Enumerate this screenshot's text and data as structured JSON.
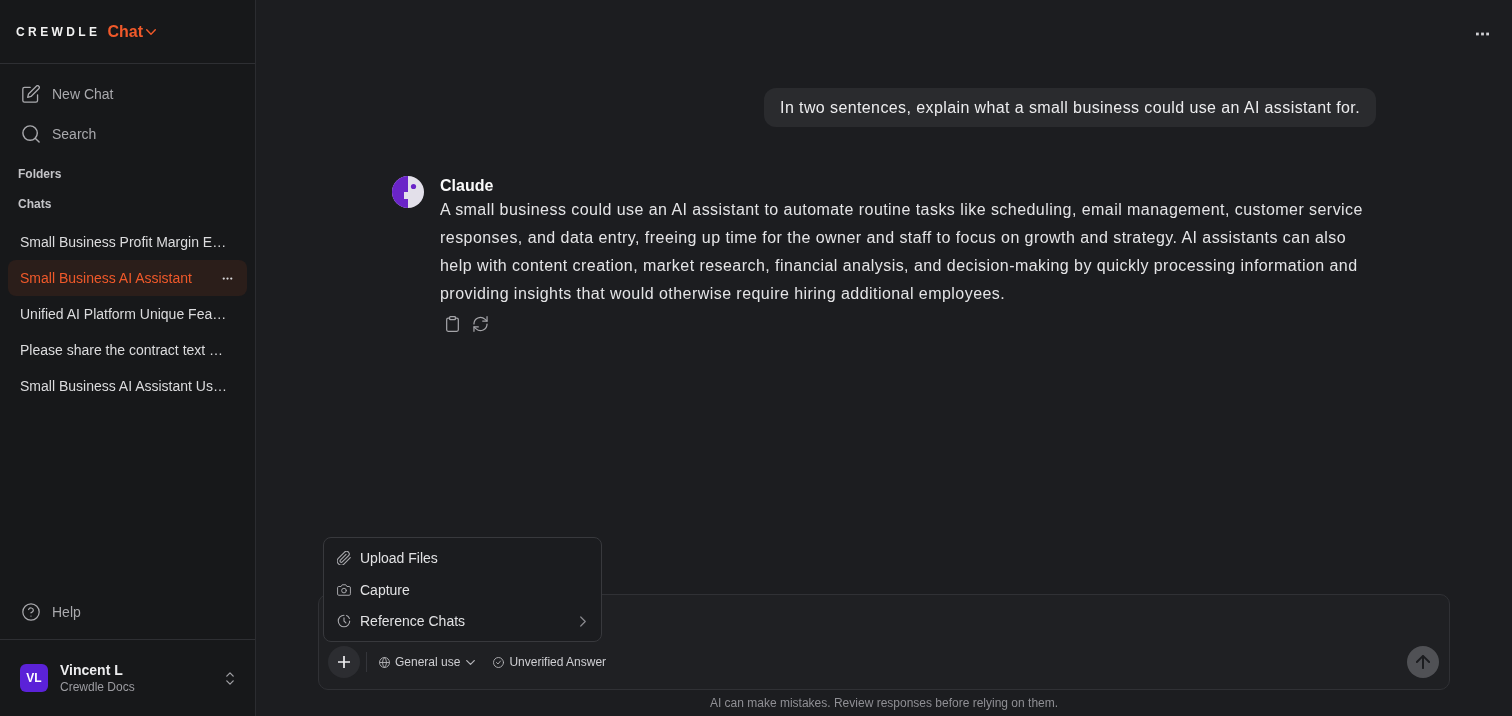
{
  "brand": {
    "wordmark": "CREWDLE",
    "product": "Chat"
  },
  "sidebar": {
    "actions": [
      {
        "kind": "new_chat",
        "label": "New Chat"
      },
      {
        "kind": "search",
        "label": "Search"
      }
    ],
    "folders_heading": "Folders",
    "chats_heading": "Chats",
    "chats": [
      {
        "title": "Small Business Profit Margin E…",
        "selected": false
      },
      {
        "title": "Small Business AI Assistant",
        "selected": true
      },
      {
        "title": "Unified AI Platform Unique Fea…",
        "selected": false
      },
      {
        "title": "Please share the contract text …",
        "selected": false
      },
      {
        "title": "Small Business AI Assistant Us…",
        "selected": false
      }
    ],
    "help": "Help",
    "user": {
      "initials": "VL",
      "name": "Vincent L",
      "workspace": "Crewdle Docs"
    }
  },
  "conversation": [
    {
      "kind": "user",
      "text": "In two sentences, explain what a small business could use an AI assistant for."
    },
    {
      "kind": "assistant",
      "sender": "Claude",
      "text": "A small business could use an AI assistant to automate routine tasks like scheduling, email management, customer service responses, and data entry, freeing up time for the owner and staff to focus on growth and strategy. AI assistants can also help with content creation, market research, financial analysis, and decision-making by quickly processing information and providing insights that would otherwise require hiring additional employees."
    }
  ],
  "composer": {
    "menu": [
      {
        "kind": "upload",
        "label": "Upload Files",
        "submenu": false
      },
      {
        "kind": "capture",
        "label": "Capture",
        "submenu": false
      },
      {
        "kind": "reference",
        "label": "Reference Chats",
        "submenu": true
      }
    ],
    "mode": "General use",
    "verification": "Unverified Answer",
    "send_disabled": true
  },
  "disclaimer": "AI can make mistakes. Review responses before relying on them."
}
